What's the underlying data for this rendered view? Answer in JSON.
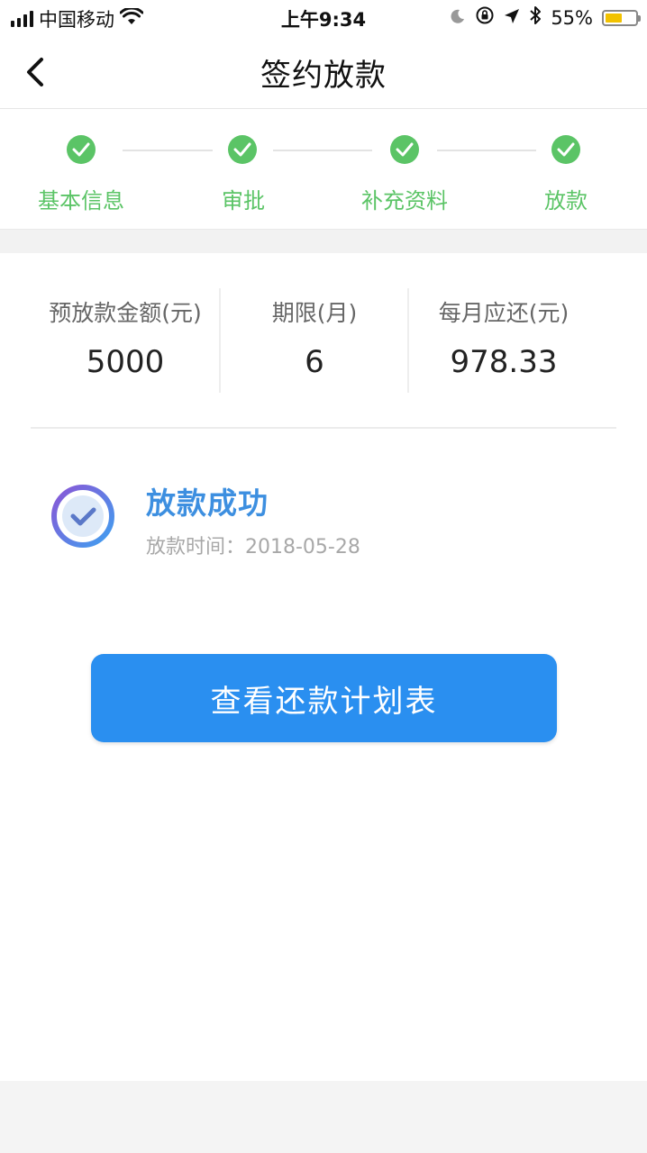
{
  "status_bar": {
    "carrier": "中国移动",
    "time": "上午9:34",
    "battery_percent": "55%",
    "battery_level": 0.55,
    "battery_color": "#f2c200"
  },
  "nav": {
    "title": "签约放款",
    "back_icon": "chevron-left-icon"
  },
  "steps": [
    {
      "label": "基本信息",
      "done": true
    },
    {
      "label": "审批",
      "done": true
    },
    {
      "label": "补充资料",
      "done": true
    },
    {
      "label": "放款",
      "done": true
    }
  ],
  "summary": [
    {
      "header": "预放款金额(元)",
      "value": "5000"
    },
    {
      "header": "期限(月)",
      "value": "6"
    },
    {
      "header": "每月应还(元)",
      "value": "978.33"
    }
  ],
  "result": {
    "title": "放款成功",
    "time": "放款时间：2018-05-28",
    "icon": "check-circle-icon"
  },
  "cta": {
    "label": "查看还款计划表"
  },
  "colors": {
    "accent_green": "#5bc466",
    "accent_blue": "#2a8ff0",
    "title_blue": "#3d8fe0"
  }
}
